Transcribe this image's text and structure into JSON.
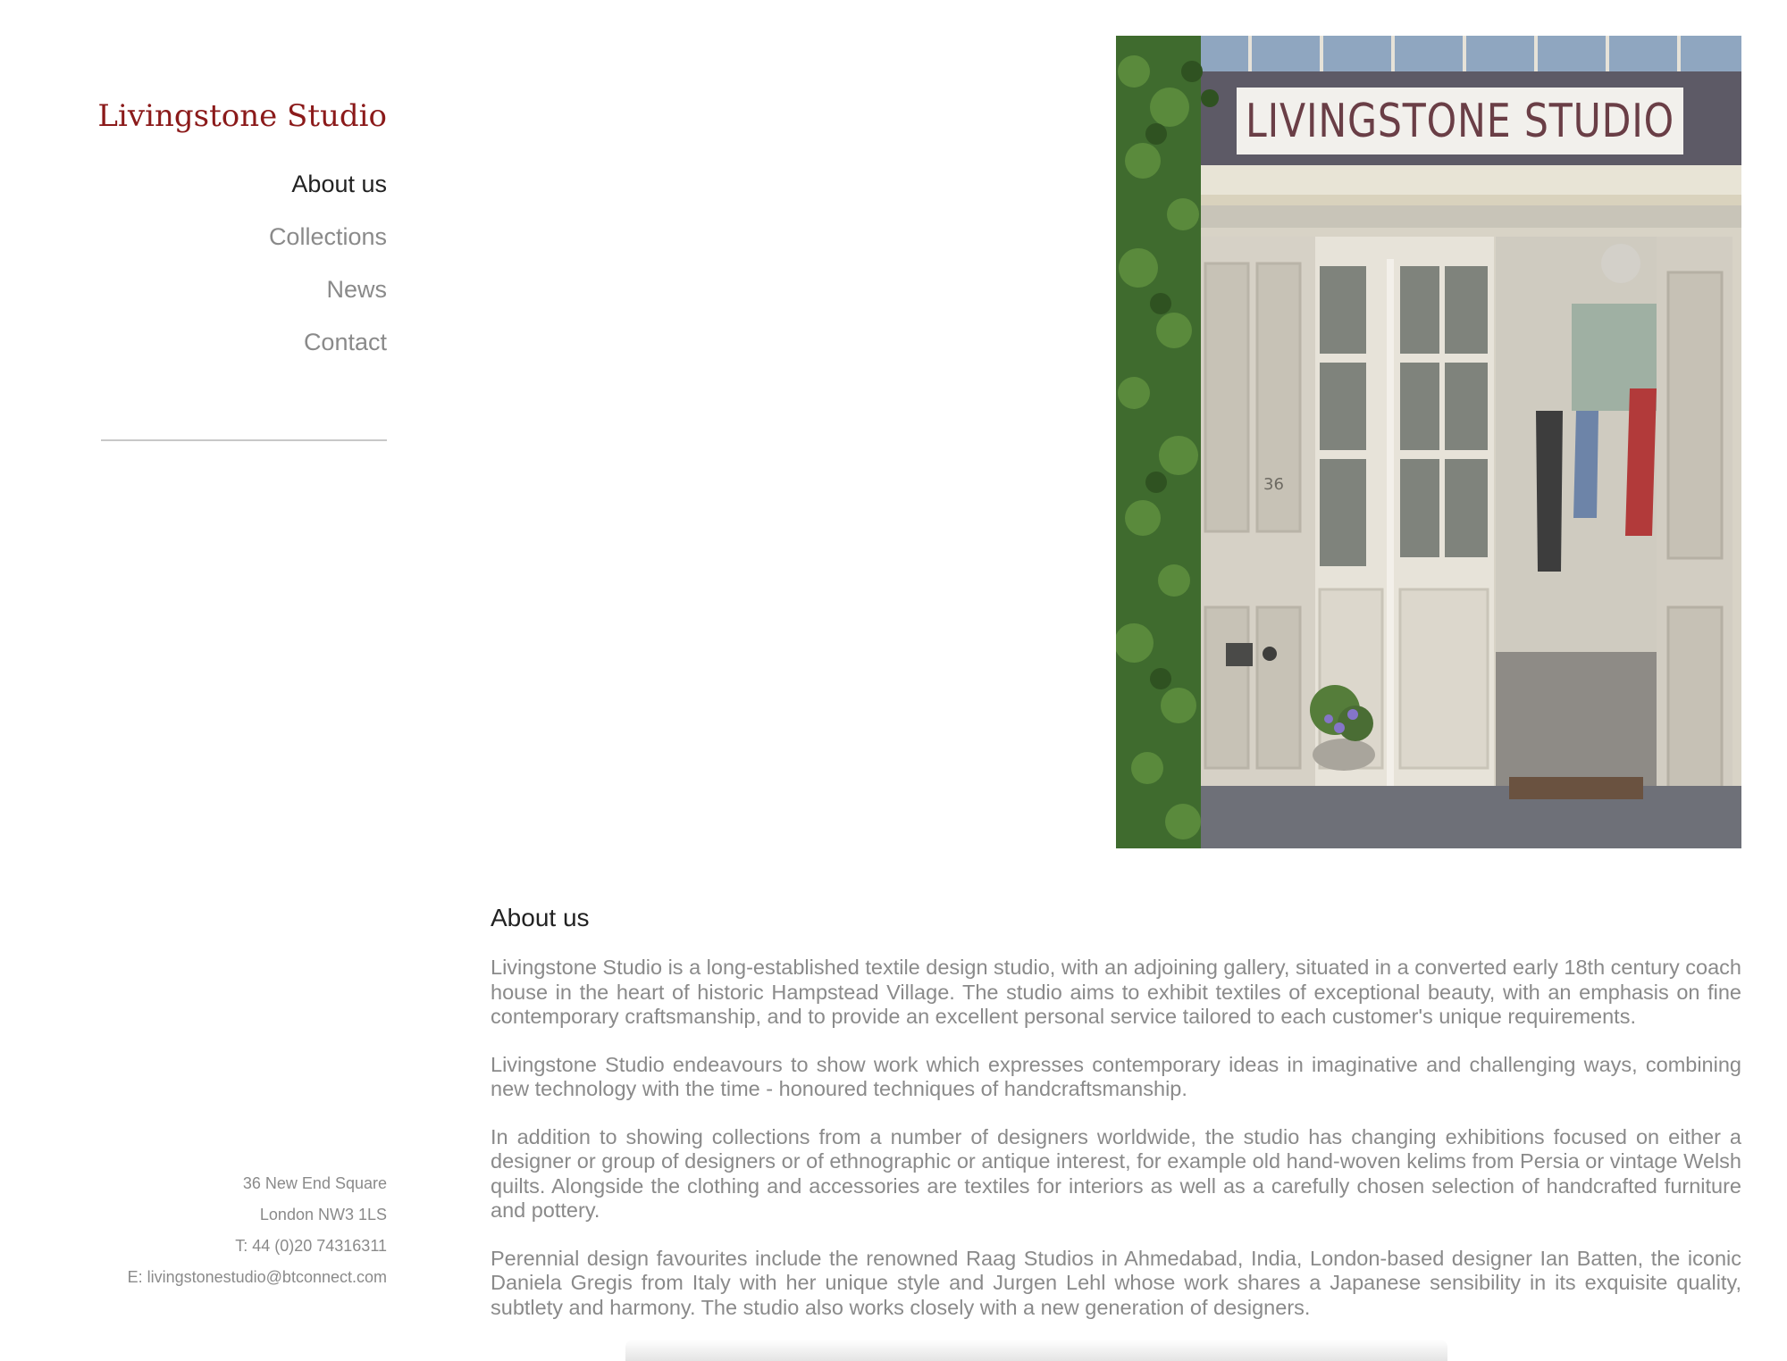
{
  "sidebar": {
    "brand": "Livingstone Studio",
    "nav": [
      {
        "label": "About us",
        "active": true
      },
      {
        "label": "Collections",
        "active": false
      },
      {
        "label": "News",
        "active": false
      },
      {
        "label": "Contact",
        "active": false
      }
    ],
    "address": {
      "line1": "36 New End Square",
      "line2": "London NW3 1LS",
      "phone": "T: 44 (0)20 74316311",
      "email": "E: livingstonestudio@btconnect.com"
    }
  },
  "hero": {
    "sign_text": "LIVINGSTONE STUDIO",
    "door_number": "36"
  },
  "main": {
    "heading": "About us",
    "paragraphs": [
      "Livingstone Studio is a long-established textile design studio, with an adjoining gallery, situated in a converted early 18th century coach house in the heart of historic Hampstead Village. The studio aims to exhibit textiles of exceptional beauty, with an emphasis on fine contemporary craftsmanship, and to provide an excellent personal service tailored to each customer's unique requirements.",
      "Livingstone Studio endeavours to show work which expresses contemporary ideas in imaginative and challenging ways, combining new technology with the time - honoured techniques of handcraftsmanship.",
      "In addition to showing collections from a number of designers worldwide, the studio has changing exhibitions focused on either a designer or group of designers or of ethnographic or antique interest, for example old hand-woven kelims from Persia or vintage Welsh quilts. Alongside the clothing and accessories are textiles for interiors as well as a carefully chosen selection of handcrafted furniture and pottery.",
      "Perennial design favourites include the renowned Raag Studios in Ahmedabad, India, London-based designer Ian Batten, the iconic Daniela Gregis from Italy with her unique style and Jurgen Lehl whose work shares a Japanese sensibility in its exquisite quality, subtlety and harmony. The studio also works closely with a new generation of designers."
    ]
  },
  "colors": {
    "brand": "#8b1a1a",
    "nav_active": "#222222",
    "nav_inactive": "#8a8a8a",
    "body_text": "#8a8a8a"
  }
}
